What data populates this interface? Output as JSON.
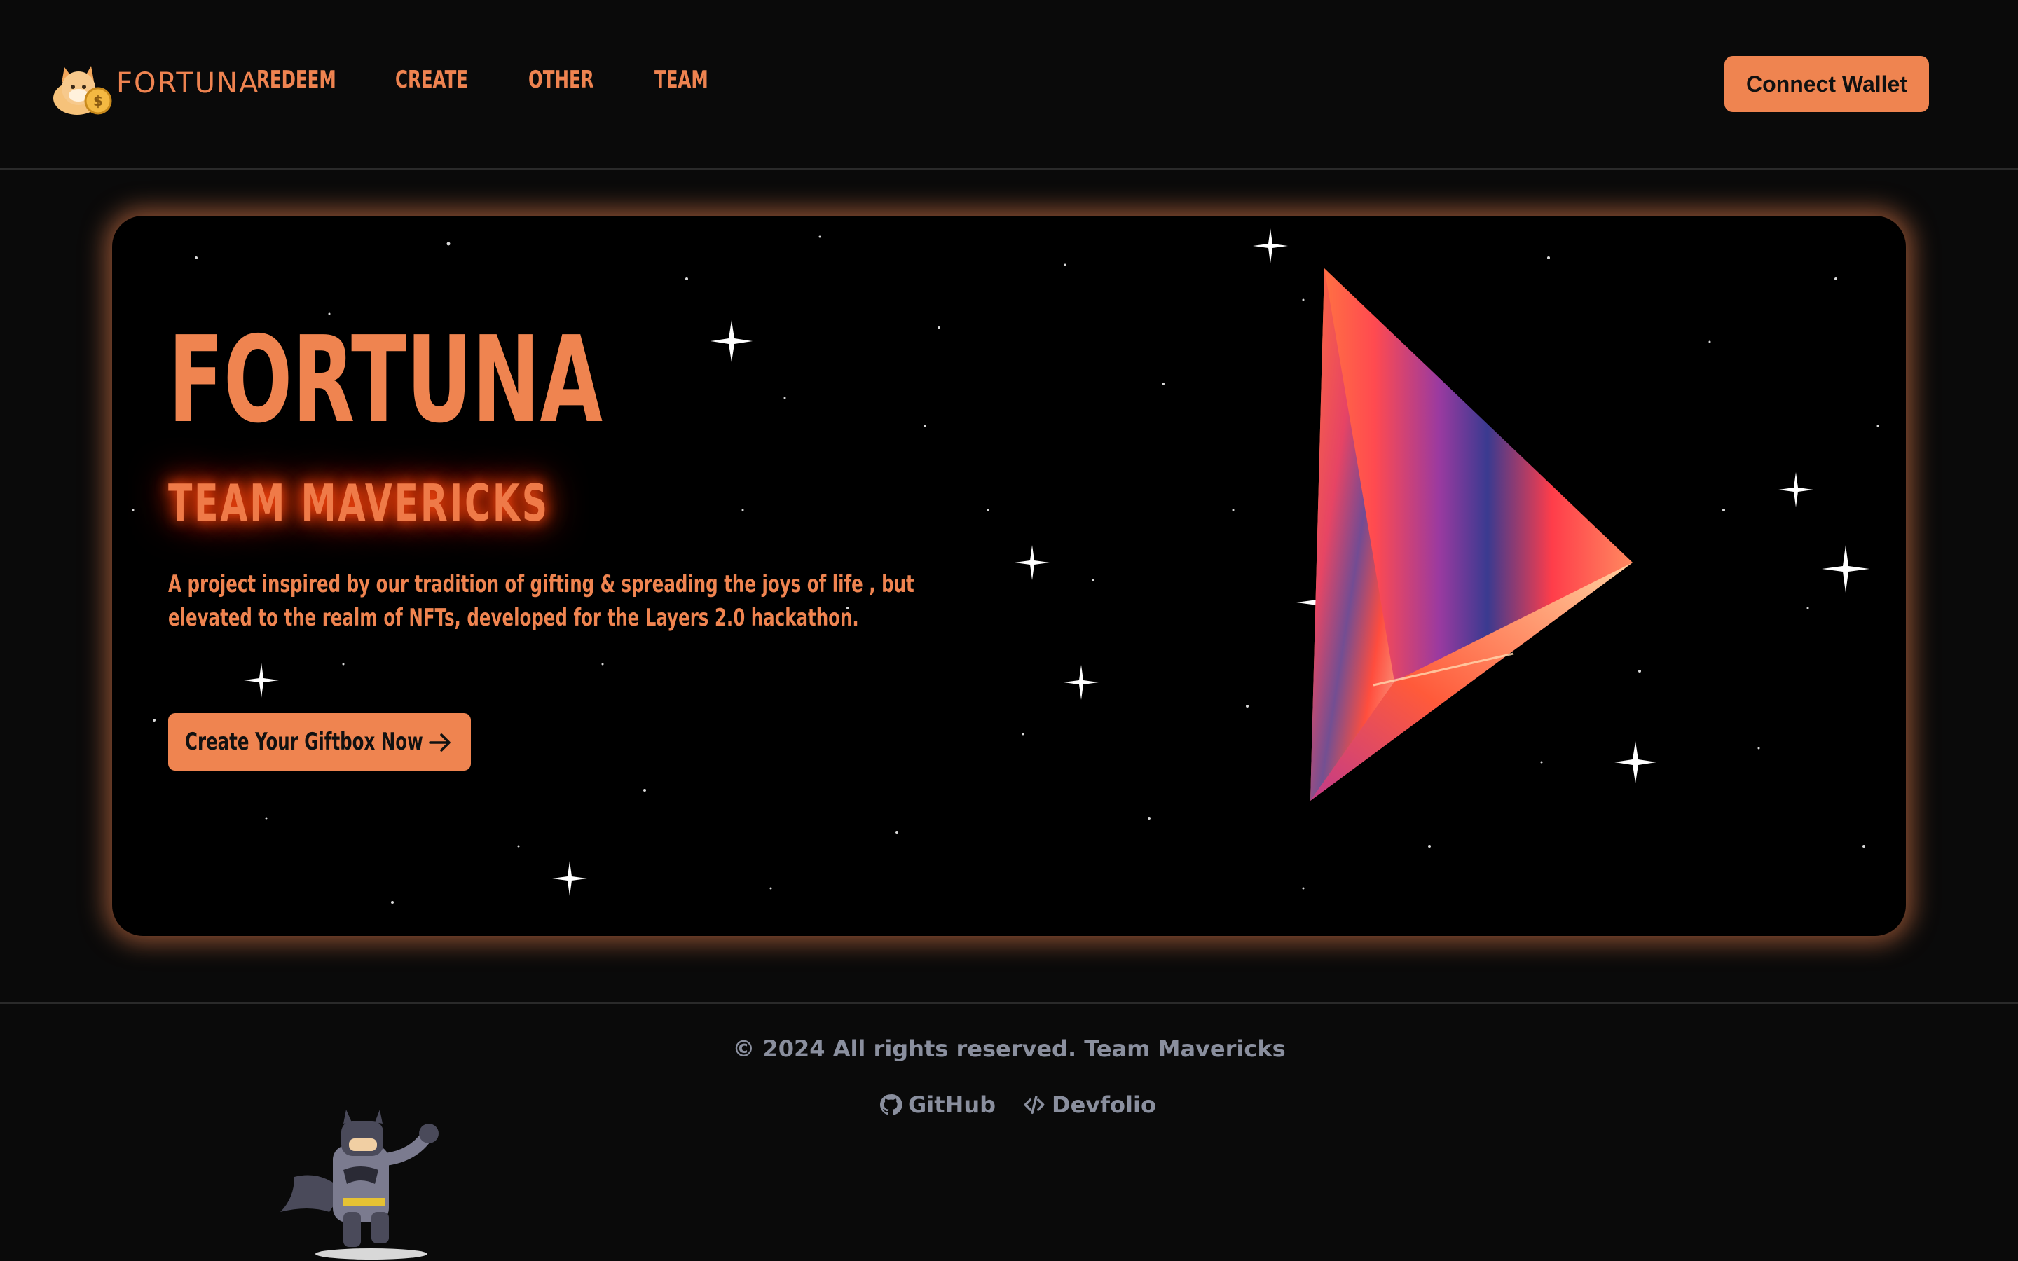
{
  "header": {
    "logo_text": "FORTUNA",
    "nav": [
      "REDEEM",
      "CREATE",
      "OTHER",
      "TEAM"
    ],
    "connect_wallet": "Connect Wallet"
  },
  "hero": {
    "title": "FORTUNA",
    "subtitle": "TEAM MAVERICKS",
    "description": "A project inspired by our tradition of gifting & spreading the joys of life , but elevated to the realm of NFTs, developed for the Layers 2.0 hackathon.",
    "cta_label": "Create Your Giftbox Now",
    "cta_icon": "arrow-right-icon",
    "illustration": "prism-pyramid"
  },
  "footer": {
    "copyright": "© 2024 All rights reserved. Team Mavericks",
    "links": [
      {
        "label": "GitHub",
        "icon": "github-icon"
      },
      {
        "label": "Devfolio",
        "icon": "code-icon"
      }
    ],
    "mascot": "batman-cartoon"
  },
  "colors": {
    "accent": "#ef8450",
    "background": "#0a0a0a",
    "hero_background": "#000000",
    "footer_text": "#8a8f9e"
  }
}
